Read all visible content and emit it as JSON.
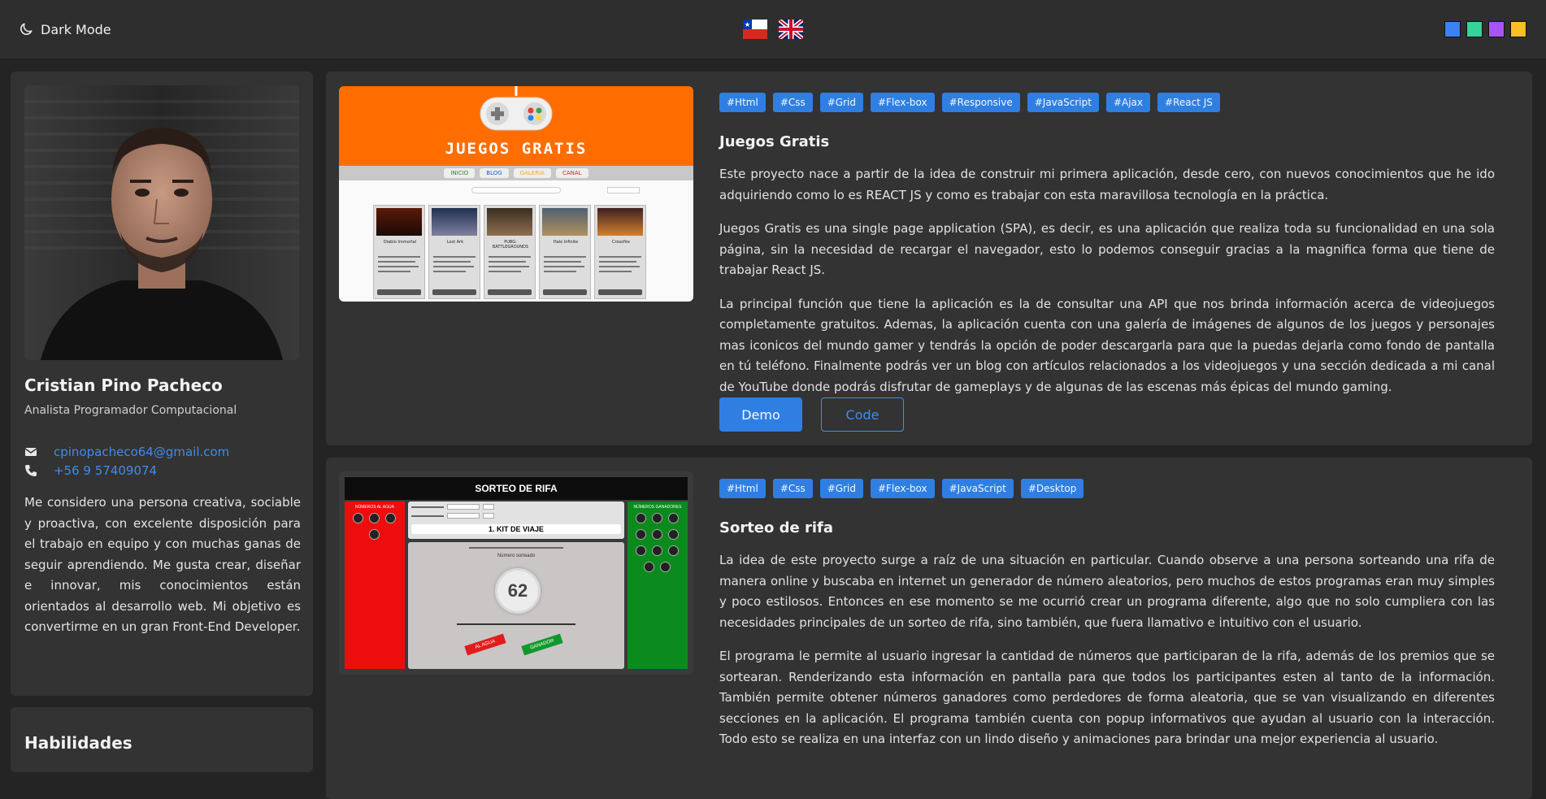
{
  "header": {
    "dark_mode_label": "Dark Mode",
    "flags": [
      "chile-flag-icon",
      "uk-flag-icon"
    ],
    "theme_colors": [
      "#3b82f6",
      "#34d399",
      "#a855f7",
      "#fbbf24"
    ]
  },
  "profile": {
    "name": "Cristian Pino Pacheco",
    "role": "Analista Programador Computacional",
    "email": "cpinopacheco64@gmail.com",
    "phone": "+56 9 57409074",
    "bio": "Me considero una persona creativa, sociable y proactiva, con excelente disposición para el trabajo en equipo y con muchas ganas de seguir aprendiendo. Me gusta crear, diseñar e innovar, mis conocimientos están orientados al desarrollo web. Mi objetivo es convertirme en un gran Front-End Developer."
  },
  "skills": {
    "title": "Habilidades"
  },
  "projects": [
    {
      "tags": [
        "#Html",
        "#Css",
        "#Grid",
        "#Flex-box",
        "#Responsive",
        "#JavaScript",
        "#Ajax",
        "#React JS"
      ],
      "title": "Juegos Gratis",
      "paragraphs": [
        "Este proyecto nace a partir de la idea de construir mi primera aplicación, desde cero, con nuevos conocimientos que he ido adquiriendo como lo es REACT JS y como es trabajar con esta maravillosa tecnología en la práctica.",
        "Juegos Gratis es una single page application (SPA), es decir, es una aplicación que realiza toda su funcionalidad en una sola página, sin la necesidad de recargar el navegador, esto lo podemos conseguir gracias a la magnifica forma que tiene de trabajar React JS.",
        "La principal función que tiene la aplicación es la de consultar una API que nos brinda información acerca de videojuegos completamente gratuitos. Ademas, la aplicación cuenta con una galería de imágenes de algunos de los juegos y personajes mas iconicos del mundo gamer y tendrás la opción de poder descargarla para que la puedas dejarla como fondo de pantalla en tú teléfono. Finalmente podrás ver un blog con artículos relacionados a los videojuegos y una sección dedicada a mi canal de YouTube donde podrás disfrutar de gameplays y de algunas de las escenas más épicas del mundo gaming."
      ],
      "demo_label": "Demo",
      "code_label": "Code",
      "thumb": {
        "title": "JUEGOS GRATIS",
        "nav": [
          "INICIO",
          "BLOG",
          "GALERIA",
          "CANAL"
        ],
        "games": [
          "Diablo Immortal",
          "Lost Ark",
          "PUBG: BATTLEGROUNDS",
          "Halo Infinite",
          "Crossfire"
        ]
      }
    },
    {
      "tags": [
        "#Html",
        "#Css",
        "#Grid",
        "#Flex-box",
        "#JavaScript",
        "#Desktop"
      ],
      "title": "Sorteo de rifa",
      "paragraphs": [
        "La idea de este proyecto surge a raíz de una situación en particular. Cuando observe a una persona sorteando una rifa de manera online y buscaba en internet un generador de número aleatorios, pero muchos de estos programas eran muy simples y poco estilosos. Entonces en ese momento se me ocurrió crear un programa diferente, algo que no solo cumpliera con las necesidades principales de un sorteo de rifa, sino también, que fuera llamativo e intuitivo con el usuario.",
        "El programa le permite al usuario ingresar la cantidad de números que participaran de la rifa, además de los premios que se sortearan. Renderizando esta información en pantalla para que todos los participantes esten al tanto de la información. También permite obtener números ganadores como perdedores de forma aleatoria, que se van visualizando en diferentes secciones en la aplicación. El programa también cuenta con popup informativos que ayudan al usuario con la interacción. Todo esto se realiza en una interfaz con un lindo diseño y animaciones para brindar una mejor experiencia al usuario."
      ],
      "thumb": {
        "title": "SORTEO DE RIFA",
        "left_label": "NÚMEROS AL AGUA",
        "right_label": "NÚMEROS GANADORES",
        "prize": "1. KIT DE VIAJE",
        "number_label": "Número sorteado",
        "number": "62",
        "btn_agua": "AL AGUA",
        "btn_ganador": "GANADOR"
      }
    }
  ]
}
